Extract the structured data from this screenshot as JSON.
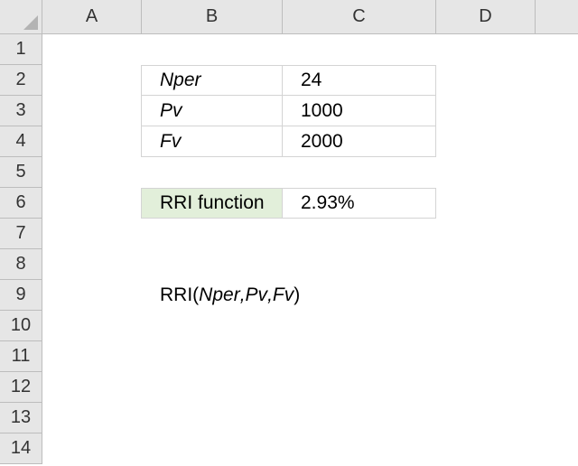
{
  "columns": [
    "A",
    "B",
    "C",
    "D"
  ],
  "rows": [
    "1",
    "2",
    "3",
    "4",
    "5",
    "6",
    "7",
    "8",
    "9",
    "10",
    "11",
    "12",
    "13",
    "14"
  ],
  "table": {
    "r2": {
      "label": "Nper",
      "value": "24"
    },
    "r3": {
      "label": "Pv",
      "value": "1000"
    },
    "r4": {
      "label": "Fv",
      "value": "2000"
    }
  },
  "result": {
    "label": "RRI function",
    "value": "2.93%"
  },
  "syntax": {
    "fn": "RRI(",
    "arg1": "Nper",
    "sep1": " , ",
    "arg2": "Pv",
    "sep2": " , ",
    "arg3": "Fv",
    "close": " )"
  },
  "colors": {
    "result_fill": "#e2efda",
    "header_bg": "#e6e6e6"
  }
}
